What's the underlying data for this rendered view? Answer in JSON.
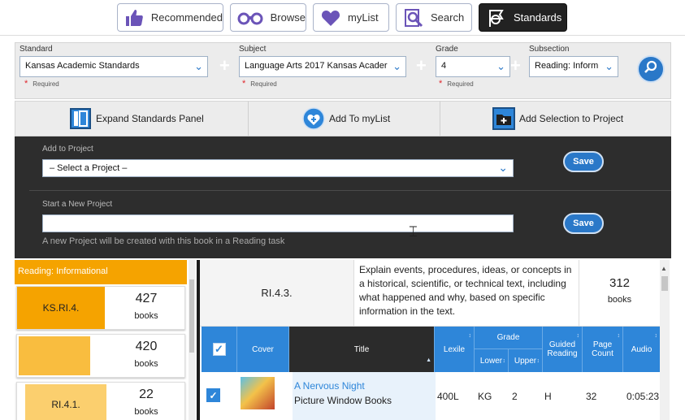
{
  "nav": {
    "items": [
      {
        "label": "Recommended",
        "icon": "thumbs-up-icon"
      },
      {
        "label": "Browse",
        "icon": "binoculars-icon"
      },
      {
        "label": "myList",
        "icon": "heart-icon"
      },
      {
        "label": "Search",
        "icon": "magnifier-book-icon"
      },
      {
        "label": "Standards",
        "icon": "flag-icon",
        "active": true
      }
    ]
  },
  "filters": {
    "standard": {
      "label": "Standard",
      "value": "Kansas Academic Standards",
      "required": "Required"
    },
    "subject": {
      "label": "Subject",
      "value": "Language Arts 2017 Kansas Acader",
      "required": "Required"
    },
    "grade": {
      "label": "Grade",
      "value": "4",
      "required": "Required"
    },
    "subsection": {
      "label": "Subsection",
      "value": "Reading: Inform"
    }
  },
  "actions": {
    "expand": "Expand Standards Panel",
    "add_mylist": "Add To myList",
    "add_project": "Add Selection to Project"
  },
  "project": {
    "add_label": "Add to Project",
    "select_value": "– Select a Project –",
    "save1": "Save",
    "new_label": "Start a New Project",
    "new_value": "",
    "save2": "Save",
    "note": "A new Project will be created with this book in a Reading task"
  },
  "left": {
    "header": "Reading: Informational",
    "cards": [
      {
        "code": "KS.RI.4.",
        "count": "427",
        "unit": "books",
        "color": "#f5a300"
      },
      {
        "code": "",
        "count": "420",
        "unit": "books",
        "color": "#f9bd3f"
      },
      {
        "code": "RI.4.1.",
        "count": "22",
        "unit": "books",
        "color": "#fbcf6e"
      }
    ]
  },
  "standard": {
    "code": "RI.4.3.",
    "description": "Explain events, procedures, ideas, or concepts in a historical, scientific, or technical text, including what happened and why, based on specific information in the text.",
    "count": "312",
    "unit": "books"
  },
  "table": {
    "headers": {
      "cover": "Cover",
      "title": "Title",
      "lexile": "Lexile",
      "grade": "Grade",
      "lower": "Lower",
      "upper": "Upper",
      "guided": "Guided Reading",
      "pages": "Page Count",
      "audio": "Audio"
    },
    "rows": [
      {
        "title": "A Nervous Night",
        "publisher": "Picture Window Books",
        "lexile": "400L",
        "lower": "KG",
        "upper": "2",
        "guided": "H",
        "pages": "32",
        "audio": "0:05:23"
      }
    ]
  }
}
